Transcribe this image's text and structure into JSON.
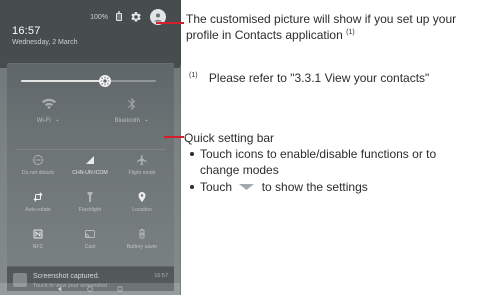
{
  "phone": {
    "status": {
      "battery": "100%",
      "time": "16:57",
      "date": "Wednesday, 2 March"
    },
    "brightness_level_pct": 62,
    "toggles": {
      "wifi_label": "Wi-Fi",
      "bluetooth_label": "Bluetooth"
    },
    "tiles": [
      {
        "label": "Do not disturb",
        "icon": "do-not-disturb-icon",
        "state": "off"
      },
      {
        "label": "CHN-UN ICOM",
        "icon": "signal-icon",
        "state": "on"
      },
      {
        "label": "Flight mode",
        "icon": "airplane-icon",
        "state": "off"
      },
      {
        "label": "Auto-rotate",
        "icon": "auto-rotate-icon",
        "state": "on"
      },
      {
        "label": "Flashlight",
        "icon": "flashlight-icon",
        "state": "off"
      },
      {
        "label": "Location",
        "icon": "location-icon",
        "state": "on"
      },
      {
        "label": "NFC",
        "icon": "nfc-icon",
        "state": "on"
      },
      {
        "label": "Cast",
        "icon": "cast-icon",
        "state": "off"
      },
      {
        "label": "Battery saver",
        "icon": "battery-saver-icon",
        "state": "off"
      }
    ],
    "notification": {
      "title": "Screenshot captured.",
      "subtitle": "Touch to view your screenshot",
      "time": "16:57"
    }
  },
  "doc": {
    "callout_top_text": "The customised picture will show if you set up your profile in Contacts application",
    "callout_top_sup": "(1)",
    "footnote_marker": "(1)",
    "footnote_text": "Please refer to \"3.3.1 View your contacts\"",
    "quick_setting_title": "Quick setting bar",
    "bullets": [
      "Touch icons to enable/disable functions or to change modes",
      "Touch",
      "to show the settings"
    ]
  },
  "colors": {
    "callout_red": "#d61f2b",
    "page_bg": "#ffffff",
    "doc_text": "#2c2c2c",
    "phone_shade_dark": "#474c4f",
    "phone_shade_mid": "#5a6063"
  }
}
